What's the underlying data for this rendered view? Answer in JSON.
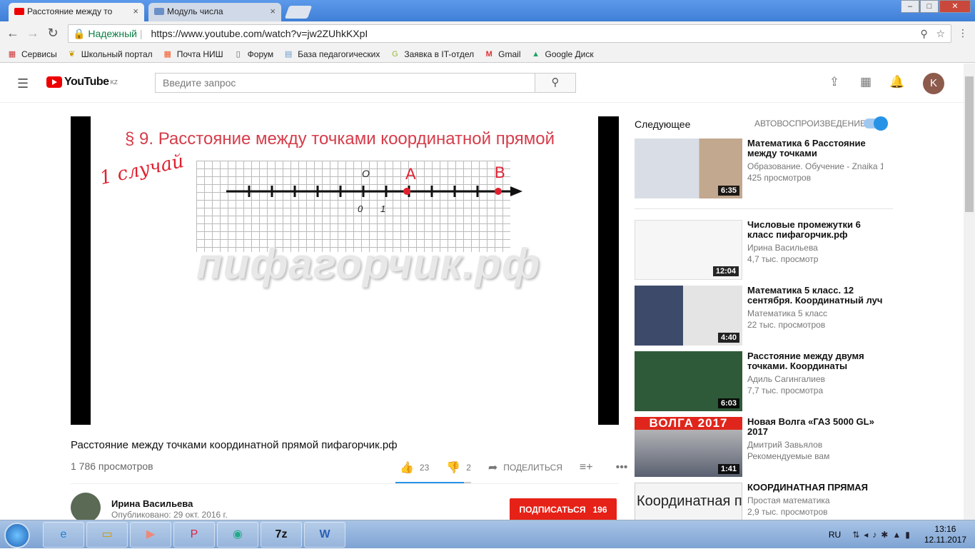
{
  "browser": {
    "tabs": [
      {
        "title": "Расстояние между то"
      },
      {
        "title": "Модуль числа"
      }
    ],
    "secure_label": "Надежный",
    "url": "https://www.youtube.com/watch?v=jw2ZUhkKXpI",
    "bookmarks": [
      "Сервисы",
      "Школьный портал",
      "Почта НИШ",
      "Форум",
      "База педагогических",
      "Заявка в IT-отдел",
      "Gmail",
      "Google Диск"
    ]
  },
  "youtube": {
    "logo_text": "YouTube",
    "region": "KZ",
    "search_placeholder": "Введите запрос",
    "avatar_letter": "K"
  },
  "video": {
    "slide_title": "§ 9. Расстояние между точками координатной прямой",
    "slide_case": "1 случай",
    "label_o": "O",
    "label_a": "A",
    "label_b": "B",
    "tick_0": "0",
    "tick_1": "1",
    "watermark": "пифагорчик.рф",
    "title": "Расстояние между точками координатной прямой пифагорчик.рф",
    "views": "1 786 просмотров",
    "likes": "23",
    "dislikes": "2",
    "share_label": "ПОДЕЛИТЬСЯ",
    "channel": "Ирина Васильева",
    "published": "Опубликовано: 29 окт. 2016 г.",
    "subscribe_label": "ПОДПИСАТЬСЯ",
    "subscribers": "196"
  },
  "sidebar": {
    "next_label": "Следующее",
    "autoplay_label": "АВТОВОСПРОИЗВЕДЕНИЕ",
    "items": [
      {
        "title": "Математика 6 Расстояние между точками",
        "channel": "Образование. Обучение - Znaika 1",
        "views": "425 просмотров",
        "duration": "6:35"
      },
      {
        "title": "Числовые промежутки 6 класс пифагорчик.рф",
        "channel": "Ирина Васильева",
        "views": "4,7 тыс. просмотр",
        "duration": "12:04"
      },
      {
        "title": "Математика 5 класс. 12 сентября. Координатный луч",
        "channel": "Математика 5 класс",
        "views": "22 тыс. просмотров",
        "duration": "4:40"
      },
      {
        "title": "Расстояние между двумя точками. Координаты",
        "channel": "Адиль Сагингалиев",
        "views": "7,7 тыс. просмотра",
        "duration": "6:03"
      },
      {
        "title": "Новая Волга «ГАЗ 5000 GL» 2017",
        "channel": "Дмитрий Завьялов",
        "views": "Рекомендуемые вам",
        "duration": "1:41",
        "thumb_text": "ВОЛГА 2017"
      },
      {
        "title": "КООРДИНАТНАЯ ПРЯМАЯ",
        "channel": "Простая математика",
        "views": "2,9 тыс. просмотров",
        "duration": "",
        "thumb_text": "Координатная прямая"
      }
    ]
  },
  "taskbar": {
    "lang": "RU",
    "time": "13:16",
    "date": "12.11.2017"
  }
}
